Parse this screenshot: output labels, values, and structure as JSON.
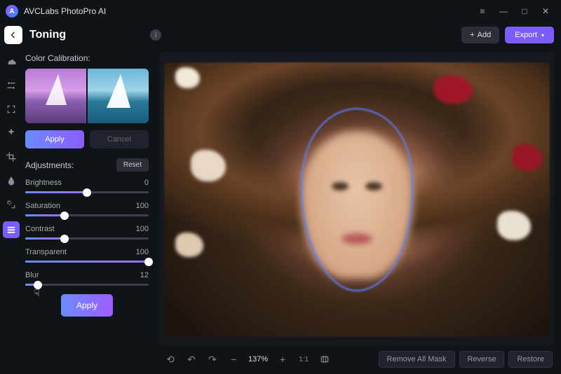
{
  "app": {
    "title": "AVCLabs PhotoPro AI",
    "logo_letter": "A"
  },
  "topbar": {
    "page_title": "Toning",
    "add_label": "Add",
    "export_label": "Export"
  },
  "calibration": {
    "label": "Color Calibration:",
    "apply_label": "Apply",
    "cancel_label": "Cancel"
  },
  "adjustments": {
    "label": "Adjustments:",
    "reset_label": "Reset",
    "sliders": [
      {
        "name": "Brightness",
        "value": 0,
        "pct": 50
      },
      {
        "name": "Saturation",
        "value": 100,
        "pct": 32
      },
      {
        "name": "Contrast",
        "value": 100,
        "pct": 32
      },
      {
        "name": "Transparent",
        "value": 100,
        "pct": 100
      },
      {
        "name": "Blur",
        "value": 12,
        "pct": 10
      }
    ],
    "apply_label": "Apply"
  },
  "bottombar": {
    "zoom": "137%",
    "ratio": "1:1",
    "remove_mask": "Remove All Mask",
    "reverse": "Reverse",
    "restore": "Restore"
  }
}
